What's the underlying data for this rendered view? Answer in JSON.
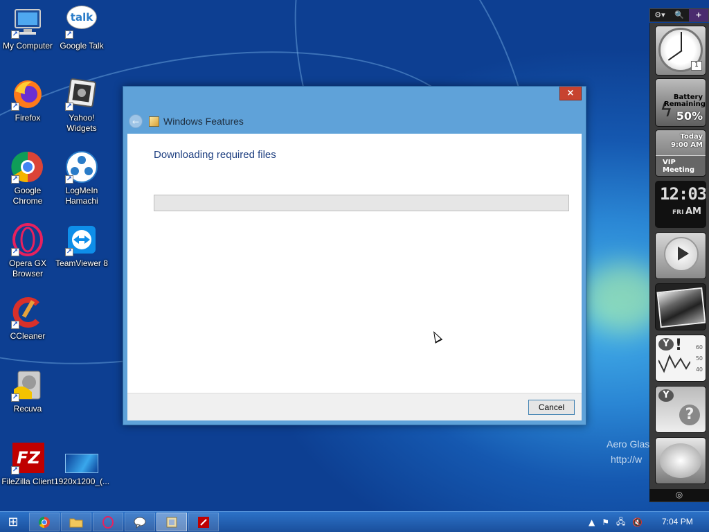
{
  "desktop": {
    "icons": [
      {
        "label": "My Computer",
        "icon": "computer-icon"
      },
      {
        "label": "Google Talk",
        "icon": "google-talk-icon"
      },
      {
        "label": "Firefox",
        "icon": "firefox-icon"
      },
      {
        "label": "Yahoo! Widgets",
        "icon": "yahoo-widgets-icon"
      },
      {
        "label": "Google Chrome",
        "icon": "chrome-icon"
      },
      {
        "label": "LogMeIn Hamachi",
        "icon": "hamachi-icon"
      },
      {
        "label": "Opera GX Browser",
        "icon": "opera-gx-icon"
      },
      {
        "label": "TeamViewer 8",
        "icon": "teamviewer-icon"
      },
      {
        "label": "CCleaner",
        "icon": "ccleaner-icon"
      },
      {
        "label": "Recuva",
        "icon": "recuva-icon"
      },
      {
        "label": "FileZilla Client",
        "icon": "filezilla-icon"
      },
      {
        "label": "1920x1200_(...",
        "icon": "wallpaper-file-icon"
      }
    ],
    "talk_glyph": "talk",
    "fz_glyph": "FZ"
  },
  "dialog": {
    "title": "Windows Features",
    "heading": "Downloading required files",
    "progress": 0,
    "cancel_label": "Cancel",
    "close_glyph": "×",
    "back_glyph": "←"
  },
  "gadgets": {
    "toolbar": [
      "⚙▾",
      "🔍",
      "+"
    ],
    "clock_date": "1",
    "battery_label": "Battery Remaining",
    "battery_value": "50%",
    "calendar_day": "Today",
    "calendar_time": "9:00 AM",
    "calendar_event": "VIP Meeting",
    "digital_time": "12:03",
    "digital_day": "FRI",
    "digital_ampm": "AM",
    "stock_y": "Y",
    "stock_ticks": [
      "60",
      "50",
      "40"
    ],
    "weather_y": "Y",
    "weather_q": "?"
  },
  "watermark": {
    "line1": "Aero Glas",
    "line2": "http://w"
  },
  "taskbar": {
    "start_glyph": "⊞",
    "buttons": [
      {
        "name": "chrome",
        "glyph": "●"
      },
      {
        "name": "explorer",
        "glyph": "▭"
      },
      {
        "name": "opera",
        "glyph": "○"
      },
      {
        "name": "chat",
        "glyph": "💬"
      },
      {
        "name": "windows-features",
        "glyph": "▣"
      },
      {
        "name": "filezilla",
        "glyph": "◼"
      }
    ],
    "tray": [
      "▲",
      "⚑",
      "🖧",
      "🔇"
    ],
    "clock": "7:04 PM"
  },
  "colors": {
    "accent": "#1e3f80",
    "close": "#c7432f",
    "taskbar": "#1a4f9c"
  }
}
